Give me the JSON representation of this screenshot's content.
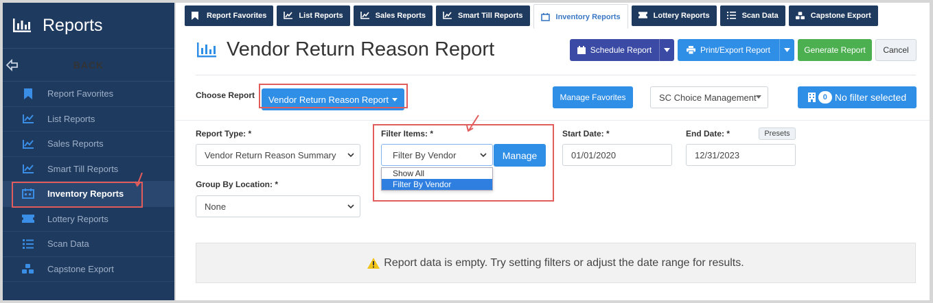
{
  "sidebar": {
    "title": "Reports",
    "back_label": "BACK",
    "items": [
      {
        "label": "Report Favorites",
        "icon": "bookmark-icon"
      },
      {
        "label": "List Reports",
        "icon": "line-chart-icon"
      },
      {
        "label": "Sales Reports",
        "icon": "line-chart-icon"
      },
      {
        "label": "Smart Till Reports",
        "icon": "line-chart-icon"
      },
      {
        "label": "Inventory Reports",
        "icon": "calendar-icon"
      },
      {
        "label": "Lottery Reports",
        "icon": "ticket-icon"
      },
      {
        "label": "Scan Data",
        "icon": "list-icon"
      },
      {
        "label": "Capstone Export",
        "icon": "cubes-icon"
      }
    ]
  },
  "tabs": [
    {
      "label": "Report Favorites"
    },
    {
      "label": "List Reports"
    },
    {
      "label": "Sales Reports"
    },
    {
      "label": "Smart Till Reports"
    },
    {
      "label": "Inventory Reports"
    },
    {
      "label": "Lottery Reports"
    },
    {
      "label": "Scan Data"
    },
    {
      "label": "Capstone Export"
    }
  ],
  "header": {
    "title": "Vendor Return Reason Report",
    "schedule_label": "Schedule Report",
    "print_label": "Print/Export Report",
    "generate_label": "Generate Report",
    "cancel_label": "Cancel"
  },
  "chooser": {
    "label": "Choose Report",
    "selected_report": "Vendor Return Reason Report",
    "manage_favorites_label": "Manage Favorites",
    "company_value": "SC Choice Management",
    "filter_count": "0",
    "filter_label": "No filter selected"
  },
  "form": {
    "report_type_label": "Report Type: *",
    "report_type_value": "Vendor Return Reason Summary",
    "group_by_label": "Group By Location: *",
    "group_by_value": "None",
    "filter_items_label": "Filter Items: *",
    "filter_items_value": "Filter By Vendor",
    "filter_options": [
      "Show All",
      "Filter By Vendor"
    ],
    "manage_label": "Manage",
    "start_date_label": "Start Date: *",
    "start_date_value": "01/01/2020",
    "end_date_label": "End Date: *",
    "end_date_value": "12/31/2023",
    "presets_label": "Presets"
  },
  "empty_message": "Report data is empty. Try setting filters or adjust the date range for results.",
  "colors": {
    "sidebar_bg": "#1f3a5f",
    "primary": "#2f8ee5",
    "schedule": "#3b4ba5",
    "generate": "#4caf50",
    "highlight": "#e25c5c"
  }
}
